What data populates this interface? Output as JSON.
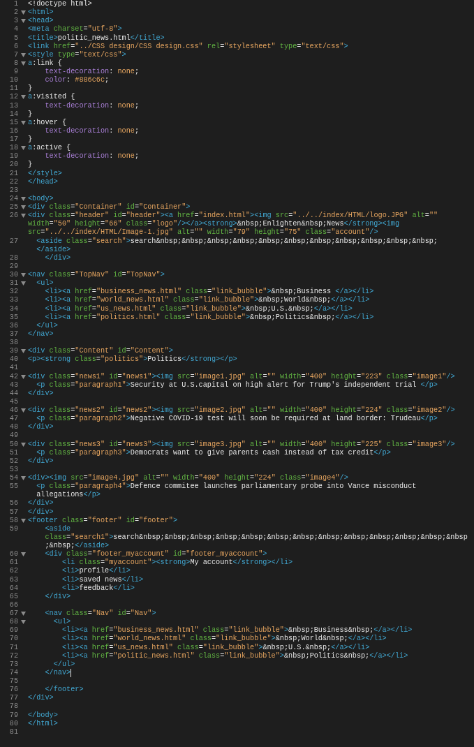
{
  "editor": {
    "lines": [
      {
        "n": "1",
        "fold": false,
        "kind": "html",
        "text": "<!doctype html>"
      },
      {
        "n": "2",
        "fold": true,
        "kind": "html",
        "text": "<html>"
      },
      {
        "n": "3",
        "fold": true,
        "kind": "html",
        "text": "<head>"
      },
      {
        "n": "4",
        "fold": false,
        "kind": "html",
        "text": "<meta charset=\"utf-8\">"
      },
      {
        "n": "5",
        "fold": false,
        "kind": "html",
        "text": "<title>politic_news.html</title>"
      },
      {
        "n": "6",
        "fold": false,
        "kind": "html",
        "text": "<link href=\"../CSS design/CSS design.css\" rel=\"stylesheet\" type=\"text/css\">"
      },
      {
        "n": "7",
        "fold": true,
        "kind": "html",
        "text": "<style type=\"text/css\">"
      },
      {
        "n": "8",
        "fold": true,
        "kind": "css",
        "text": "a:link {"
      },
      {
        "n": "9",
        "fold": false,
        "kind": "css",
        "text": "    text-decoration: none;"
      },
      {
        "n": "10",
        "fold": false,
        "kind": "css",
        "text": "    color: #886c6c;"
      },
      {
        "n": "11",
        "fold": false,
        "kind": "css",
        "text": "}"
      },
      {
        "n": "12",
        "fold": true,
        "kind": "css",
        "text": "a:visited {"
      },
      {
        "n": "13",
        "fold": false,
        "kind": "css",
        "text": "    text-decoration: none;"
      },
      {
        "n": "14",
        "fold": false,
        "kind": "css",
        "text": "}"
      },
      {
        "n": "15",
        "fold": true,
        "kind": "css",
        "text": "a:hover {"
      },
      {
        "n": "16",
        "fold": false,
        "kind": "css",
        "text": "    text-decoration: none;"
      },
      {
        "n": "17",
        "fold": false,
        "kind": "css",
        "text": "}"
      },
      {
        "n": "18",
        "fold": true,
        "kind": "css",
        "text": "a:active {"
      },
      {
        "n": "19",
        "fold": false,
        "kind": "css",
        "text": "    text-decoration: none;"
      },
      {
        "n": "20",
        "fold": false,
        "kind": "css",
        "text": "}"
      },
      {
        "n": "21",
        "fold": false,
        "kind": "html",
        "text": "</style>"
      },
      {
        "n": "22",
        "fold": false,
        "kind": "html",
        "text": "</head>"
      },
      {
        "n": "23",
        "fold": false
      },
      {
        "n": "24",
        "fold": true,
        "kind": "html",
        "text": "<body>"
      },
      {
        "n": "25",
        "fold": true,
        "kind": "html",
        "text": "<div class=\"Container\" id=\"Container\">"
      },
      {
        "n": "26",
        "fold": true,
        "kind": "html",
        "text": "<div class=\"header\" id=\"header\"><a href=\"index.html\"><img src=\"../../index/HTML/logo.JPG\" alt=\"\"",
        "wrap": [
          "width=\"50\" height=\"66\" class=\"logo\"/></a><strong>&nbsp;Enlighten&nbsp;News</strong><img",
          "src=\"../../index/HTML/Image-1.jpg\" alt=\"\" width=\"79\" height=\"75\" class=\"account\"/>"
        ]
      },
      {
        "n": "27",
        "fold": false,
        "kind": "html",
        "text": "  <aside class=\"search\">search&nbsp;&nbsp;&nbsp;&nbsp;&nbsp;&nbsp;&nbsp;&nbsp;&nbsp;&nbsp;&nbsp;",
        "wrap": [
          "  </aside>"
        ]
      },
      {
        "n": "28",
        "fold": false,
        "kind": "html",
        "text": "    </div>"
      },
      {
        "n": "29",
        "fold": false
      },
      {
        "n": "30",
        "fold": true,
        "kind": "html",
        "text": "<nav class=\"TopNav\" id=\"TopNav\">"
      },
      {
        "n": "31",
        "fold": true,
        "kind": "html",
        "text": "  <ul>"
      },
      {
        "n": "32",
        "fold": false,
        "kind": "html",
        "text": "    <li><a href=\"business_news.html\" class=\"link_bubble\">&nbsp;Business </a></li>"
      },
      {
        "n": "33",
        "fold": false,
        "kind": "html",
        "text": "    <li><a href=\"world_news.html\" class=\"link_bubble\">&nbsp;World&nbsp;</a></li>"
      },
      {
        "n": "34",
        "fold": false,
        "kind": "html",
        "text": "    <li><a href=\"us_news.html\" class=\"link_bubble\">&nbsp;U.S.&nbsp;</a></li>"
      },
      {
        "n": "35",
        "fold": false,
        "kind": "html",
        "text": "    <li><a href=\"politics.html\" class=\"link_bubble\">&nbsp;Politics&nbsp;</a></li>"
      },
      {
        "n": "36",
        "fold": false,
        "kind": "html",
        "text": "  </ul>"
      },
      {
        "n": "37",
        "fold": false,
        "kind": "html",
        "text": "</nav>"
      },
      {
        "n": "38",
        "fold": false
      },
      {
        "n": "39",
        "fold": true,
        "kind": "html",
        "text": "<div class=\"Content\" id=\"Content\">"
      },
      {
        "n": "40",
        "fold": false,
        "kind": "html",
        "text": "<p><strong class=\"politics\">Politics</strong></p>"
      },
      {
        "n": "41",
        "fold": false
      },
      {
        "n": "42",
        "fold": true,
        "kind": "html",
        "text": "<div class=\"news1\" id=\"news1\"><img src=\"image1.jpg\" alt=\"\" width=\"400\" height=\"223\" class=\"image1\"/>"
      },
      {
        "n": "43",
        "fold": false,
        "kind": "html",
        "text": "  <p class=\"paragraph1\">Security at U.S.capital on high alert for Trump's independent trial </p>"
      },
      {
        "n": "44",
        "fold": false,
        "kind": "html",
        "text": "</div>"
      },
      {
        "n": "45",
        "fold": false
      },
      {
        "n": "46",
        "fold": true,
        "kind": "html",
        "text": "<div class=\"news2\" id=\"news2\"><img src=\"image2.jpg\" alt=\"\" width=\"400\" height=\"224\" class=\"image2\"/>"
      },
      {
        "n": "47",
        "fold": false,
        "kind": "html",
        "text": "  <p class=\"paragraph2\">Negative COVID-19 test will soon be required at land border: Trudeau</p>"
      },
      {
        "n": "48",
        "fold": false,
        "kind": "html",
        "text": "</div>"
      },
      {
        "n": "49",
        "fold": false
      },
      {
        "n": "50",
        "fold": true,
        "kind": "html",
        "text": "<div class=\"news3\" id=\"news3\"><img src=\"image3.jpg\" alt=\"\" width=\"400\" height=\"225\" class=\"image3\"/>"
      },
      {
        "n": "51",
        "fold": false,
        "kind": "html",
        "text": "  <p class=\"paragraph3\">Democrats want to give parents cash instead of tax credit</p>"
      },
      {
        "n": "52",
        "fold": false,
        "kind": "html",
        "text": "</div>"
      },
      {
        "n": "53",
        "fold": false
      },
      {
        "n": "54",
        "fold": true,
        "kind": "html",
        "text": "<div><img src=\"image4.jpg\" alt=\"\" width=\"400\" height=\"224\" class=\"image4\"/>"
      },
      {
        "n": "55",
        "fold": false,
        "kind": "html",
        "text": "  <p class=\"paragraph4\">Defence commitee launches parliamentary probe into Vance misconduct",
        "wrap": [
          "  allegations</p>"
        ]
      },
      {
        "n": "56",
        "fold": false,
        "kind": "html",
        "text": "</div>"
      },
      {
        "n": "57",
        "fold": false,
        "kind": "html",
        "text": "</div>"
      },
      {
        "n": "58",
        "fold": true,
        "kind": "html",
        "text": "<footer class=\"footer\" id=\"footer\">"
      },
      {
        "n": "59",
        "fold": false,
        "kind": "html",
        "text": "    <aside",
        "wrap": [
          "    class=\"search1\">search&nbsp;&nbsp;&nbsp;&nbsp;&nbsp;&nbsp;&nbsp;&nbsp;&nbsp;&nbsp;&nbsp;&nbsp;&nbsp",
          "    ;&nbsp;</aside>"
        ]
      },
      {
        "n": "60",
        "fold": true,
        "kind": "html",
        "text": "    <div class=\"footer_myaccount\" id=\"footer_myaccount\">"
      },
      {
        "n": "61",
        "fold": false,
        "kind": "html",
        "text": "        <li class=\"myaccount\"><strong>My account</strong></li>"
      },
      {
        "n": "62",
        "fold": false,
        "kind": "html",
        "text": "        <li>profile</li>"
      },
      {
        "n": "63",
        "fold": false,
        "kind": "html",
        "text": "        <li>saved news</li>"
      },
      {
        "n": "64",
        "fold": false,
        "kind": "html",
        "text": "        <li>feedback</li>"
      },
      {
        "n": "65",
        "fold": false,
        "kind": "html",
        "text": "    </div>"
      },
      {
        "n": "66",
        "fold": false
      },
      {
        "n": "67",
        "fold": true,
        "kind": "html",
        "text": "    <nav class=\"Nav\" id=\"Nav\">"
      },
      {
        "n": "68",
        "fold": true,
        "kind": "html",
        "text": "      <ul>"
      },
      {
        "n": "69",
        "fold": false,
        "kind": "html",
        "text": "        <li><a href=\"business_news.html\" class=\"link_bubble\">&nbsp;Business&nbsp;</a></li>"
      },
      {
        "n": "70",
        "fold": false,
        "kind": "html",
        "text": "        <li><a href=\"world_news.html\" class=\"link_bubble\">&nbsp;World&nbsp;</a></li>"
      },
      {
        "n": "71",
        "fold": false,
        "kind": "html",
        "text": "        <li><a href=\"us_news.html\" class=\"link_bubble\">&nbsp;U.S.&nbsp;</a></li>"
      },
      {
        "n": "72",
        "fold": false,
        "kind": "html",
        "text": "        <li><a href=\"politic_news.html\" class=\"link_bubble\">&nbsp;Politics&nbsp;</a></li>"
      },
      {
        "n": "73",
        "fold": false,
        "kind": "html",
        "text": "      </ul>"
      },
      {
        "n": "74",
        "fold": false,
        "kind": "html",
        "text": "    </nav>",
        "cursor": true
      },
      {
        "n": "75",
        "fold": false
      },
      {
        "n": "76",
        "fold": false,
        "kind": "html",
        "text": "    </footer>"
      },
      {
        "n": "77",
        "fold": false,
        "kind": "html",
        "text": "</div>"
      },
      {
        "n": "78",
        "fold": false
      },
      {
        "n": "79",
        "fold": false,
        "kind": "html",
        "text": "</body>"
      },
      {
        "n": "80",
        "fold": false,
        "kind": "html",
        "text": "</html>"
      },
      {
        "n": "81",
        "fold": false
      }
    ]
  }
}
